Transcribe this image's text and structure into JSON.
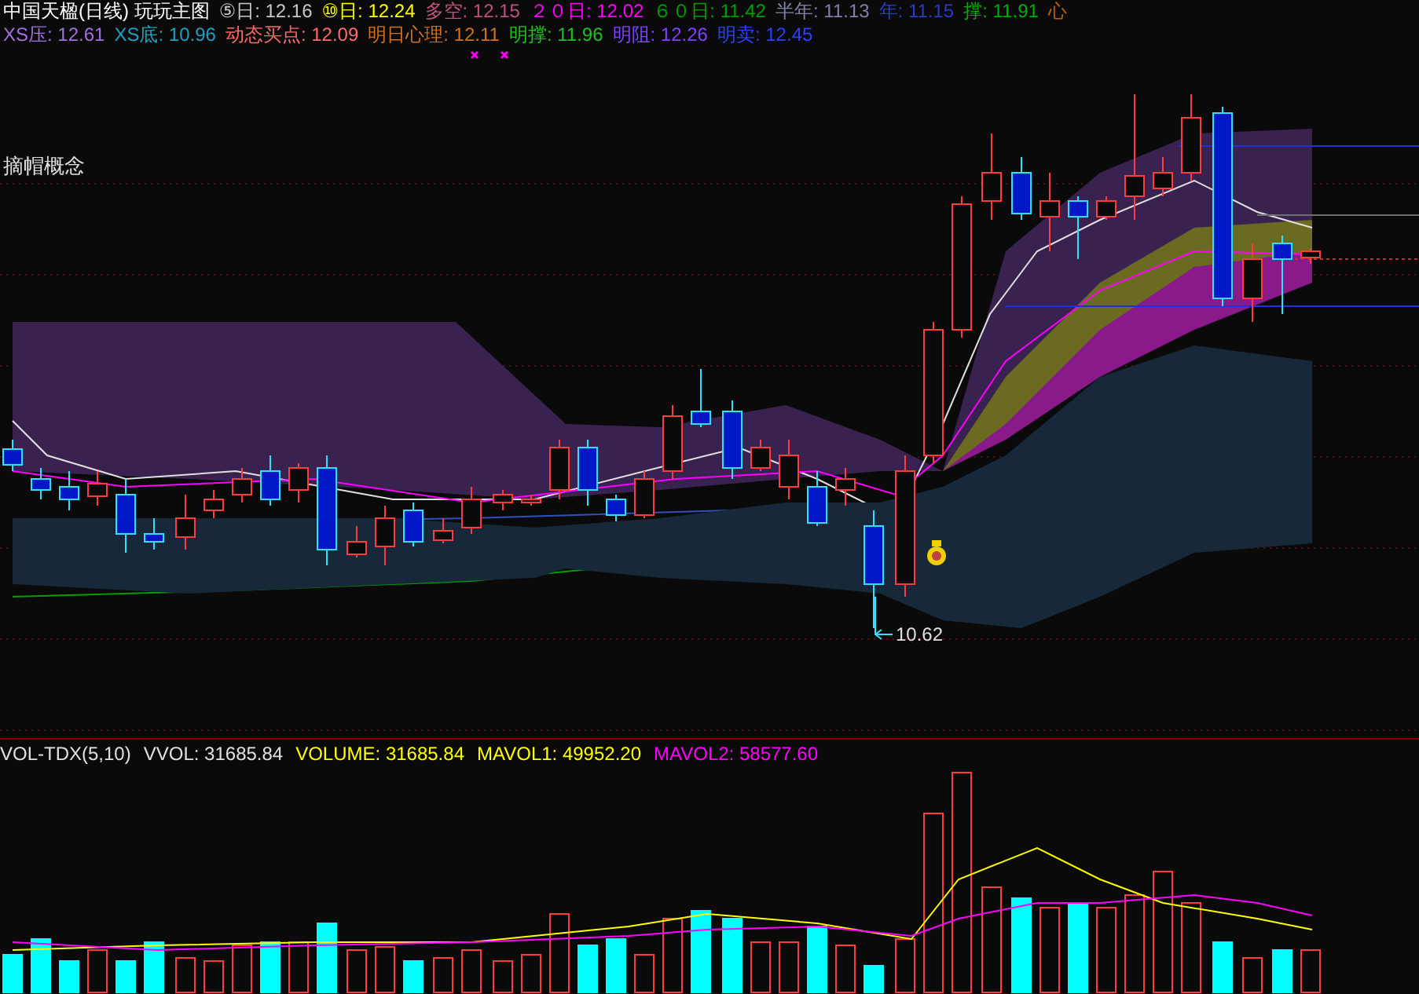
{
  "chart_title": "中国天楹(日线) 玩玩主图",
  "indicators_row_1": [
    {
      "label": "⑤日:",
      "value": "12.16",
      "color": "#c8c8c8"
    },
    {
      "label": "⑩日:",
      "value": "12.24",
      "color": "#ffff00"
    },
    {
      "label": "多空:",
      "value": "12.15",
      "color": "#c05080"
    },
    {
      "label": "２０日:",
      "value": "12.02",
      "color": "#ff00ff"
    },
    {
      "label": "６０日:",
      "value": "11.42",
      "color": "#00a000"
    },
    {
      "label": "半年:",
      "value": "11.13",
      "color": "#8080a8"
    },
    {
      "label": "年:",
      "value": "11.15",
      "color": "#2a3cc0"
    },
    {
      "label": "撑:",
      "value": "11.91",
      "color": "#00b000"
    },
    {
      "label": "心",
      "color": "#c06000"
    }
  ],
  "indicators_row_2": [
    {
      "label": "XS压:",
      "value": "12.61",
      "color": "#a070e0"
    },
    {
      "label": "XS底:",
      "value": "10.96",
      "color": "#20a0c0"
    },
    {
      "label": "动态买点:",
      "value": "12.09",
      "color": "#ff6a6a"
    },
    {
      "label": "明日心理:",
      "value": "12.11",
      "color": "#d07020"
    },
    {
      "label": "明撑:",
      "value": "11.96",
      "color": "#20c020"
    },
    {
      "label": "明阻:",
      "value": "12.26",
      "color": "#8040ff"
    },
    {
      "label": "明卖:",
      "value": "12.45",
      "color": "#2a40ff"
    }
  ],
  "concept_label": "摘帽概念",
  "low_price_label": "10.62",
  "volume_legend": [
    {
      "label": "VOL-TDX(5,10)",
      "color": "#e0e0e0"
    },
    {
      "label": "VVOL:",
      "value": "31685.84",
      "color": "#e0e0e0"
    },
    {
      "label": "VOLUME:",
      "value": "31685.84",
      "color": "#ffff00"
    },
    {
      "label": "MAVOL1:",
      "value": "49952.20",
      "color": "#ffff00"
    },
    {
      "label": "MAVOL2:",
      "value": "58577.60",
      "color": "#ff00ff"
    }
  ]
}
